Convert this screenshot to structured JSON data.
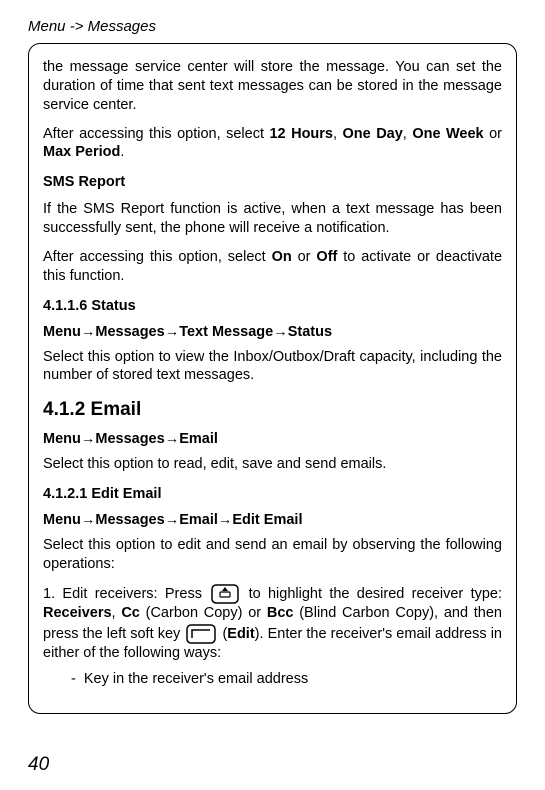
{
  "header": "Menu -> Messages",
  "p1_a": "the message service center will store the message. You can set the duration of time that sent text messages can be stored in the message service center.",
  "p1_b_pre": "After accessing this option, select ",
  "p1_b_opt1": "12 Hours",
  "p1_b_sep1": ", ",
  "p1_b_opt2": "One Day",
  "p1_b_sep2": ", ",
  "p1_b_opt3": "One Week",
  "p1_b_sep3": " or ",
  "p1_b_opt4": "Max Period",
  "p1_b_end": ".",
  "sms_report_head": "SMS Report",
  "sms_report_p1": "If the SMS Report function is active, when a text message has been successfully sent, the phone will receive a notification.",
  "sms_report_p2_pre": "After accessing this option, select ",
  "sms_report_p2_on": "On",
  "sms_report_p2_mid": " or ",
  "sms_report_p2_off": "Off",
  "sms_report_p2_end": " to activate or deactivate this function.",
  "status_head": "4.1.1.6 Status",
  "status_nav_menu": "Menu",
  "arrow": "→",
  "status_nav_msgs": "Messages",
  "status_nav_text": "Text Message",
  "status_nav_status": "Status",
  "status_p": "Select this option to view the Inbox/Outbox/Draft capacity, including the number of stored text messages.",
  "email_h2": "4.1.2 Email",
  "email_nav_email": "Email",
  "email_p": "Select this option to read, edit, save and send emails.",
  "edit_email_head": "4.1.2.1 Edit Email",
  "edit_email_nav_edit": "Edit Email",
  "edit_email_p": "Select this option to edit and send an email by observing the following operations:",
  "li1_pre": "1. Edit receivers: Press ",
  "li1_mid1": " to highlight the desired receiver type: ",
  "li1_recv": "Receivers",
  "li1_sep1": ", ",
  "li1_cc": "Cc",
  "li1_cc_exp": " (Carbon Copy) or ",
  "li1_bcc": "Bcc",
  "li1_bcc_exp": " (Blind Carbon Copy), and then press the left soft key ",
  "li1_edit_open": " (",
  "li1_edit": "Edit",
  "li1_edit_close": "). Enter the receiver's email address in either of the following ways:",
  "li1_sub": "Key in the receiver's email address",
  "page_num": "40"
}
